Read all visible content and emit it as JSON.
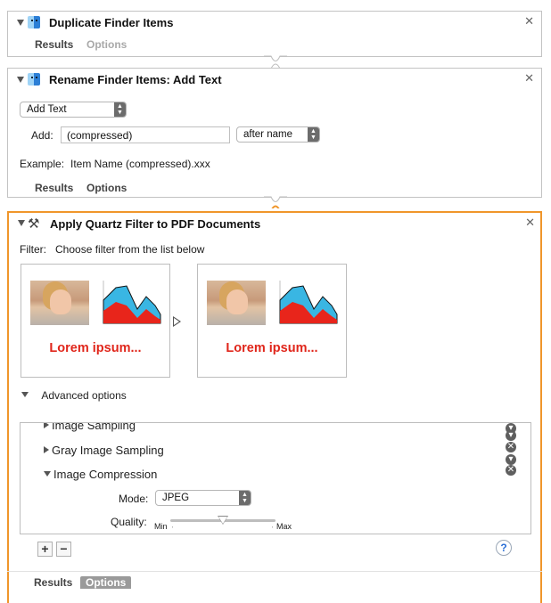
{
  "actions": [
    {
      "title": "Duplicate Finder Items",
      "tabs": {
        "results": "Results",
        "options": "Options"
      }
    },
    {
      "title": "Rename Finder Items: Add Text",
      "mode_popup": "Add Text",
      "add_label": "Add:",
      "add_value": "(compressed)",
      "position_popup": "after name",
      "example_label": "Example:",
      "example_value": "Item Name (compressed).xxx",
      "tabs": {
        "results": "Results",
        "options": "Options"
      }
    },
    {
      "title": "Apply Quartz Filter to PDF Documents",
      "filter_label": "Filter:",
      "filter_hint": "Choose filter from the list below",
      "preview_before_text": "Lorem ipsum...",
      "preview_after_text": "Lorem ipsum...",
      "advanced_label": "Advanced options",
      "list_items": [
        {
          "label": "Image Sampling",
          "expanded": false
        },
        {
          "label": "Gray Image Sampling",
          "expanded": false
        },
        {
          "label": "Image Compression",
          "expanded": true
        }
      ],
      "mode_label": "Mode:",
      "mode_value": "JPEG",
      "quality_label": "Quality:",
      "quality_min": "Min",
      "quality_max": "Max",
      "quality_level": 0.5,
      "add_button": "+",
      "remove_button": "−",
      "help_button": "?",
      "tabs": {
        "results": "Results",
        "options": "Options"
      }
    }
  ],
  "colors": {
    "active_border": "#f0962b",
    "lorem_text": "#e0261b",
    "chart_blue": "#39b6e3",
    "chart_red": "#e8251b"
  },
  "icons": {
    "close": "close-icon",
    "disclosure": "disclosure-triangle-icon",
    "finder": "finder-icon",
    "quartz": "tools-icon"
  }
}
